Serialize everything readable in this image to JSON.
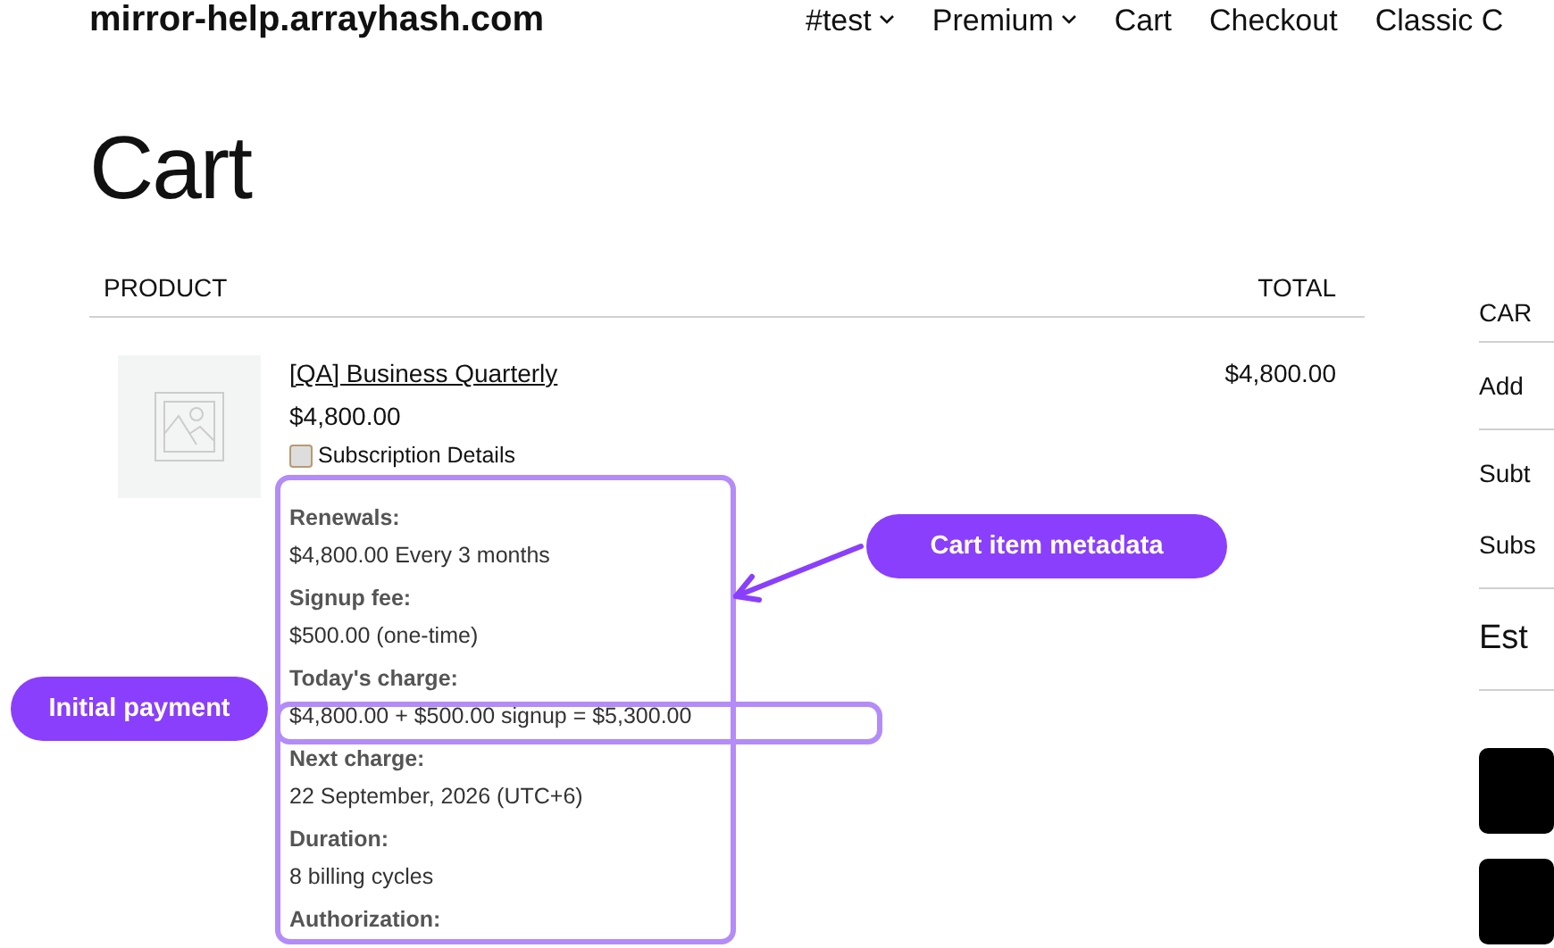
{
  "site": {
    "title": "mirror-help.arrayhash.com",
    "nav": [
      {
        "label": "#test",
        "dropdown": true
      },
      {
        "label": "Premium",
        "dropdown": true
      },
      {
        "label": "Cart",
        "dropdown": false
      },
      {
        "label": "Checkout",
        "dropdown": false
      },
      {
        "label": "Classic C",
        "dropdown": false
      }
    ]
  },
  "page_title": "Cart",
  "cart_table": {
    "columns": [
      "PRODUCT",
      "TOTAL"
    ],
    "items": [
      {
        "name": "[QA] Business Quarterly",
        "price": "$4,800.00",
        "total": "$4,800.00",
        "details_title": "Subscription Details",
        "details": [
          {
            "label": "Renewals:",
            "value": "$4,800.00 Every 3 months"
          },
          {
            "label": "Signup fee:",
            "value": "$500.00 (one-time)"
          },
          {
            "label": "Today's charge:",
            "value": "$4,800.00 + $500.00 signup = $5,300.00"
          },
          {
            "label": "Next charge:",
            "value": "22 September, 2026 (UTC+6)"
          },
          {
            "label": "Duration:",
            "value": "8 billing cycles"
          },
          {
            "label": "Authorization:"
          }
        ]
      }
    ]
  },
  "totals_panel": {
    "heading": "CAR",
    "sections": [
      {
        "kind": "plain",
        "rows": [
          "Add"
        ]
      },
      {
        "kind": "plain",
        "rows": [
          "Subt",
          "Subs"
        ]
      },
      {
        "kind": "total",
        "rows": [
          "Est"
        ]
      }
    ],
    "buttons": [
      {
        "kind": "primary"
      },
      {
        "kind": "primary"
      }
    ]
  },
  "annotations": [
    {
      "kind": "metadata",
      "label": "Cart item metadata"
    },
    {
      "kind": "charge",
      "label": "Initial payment"
    }
  ]
}
